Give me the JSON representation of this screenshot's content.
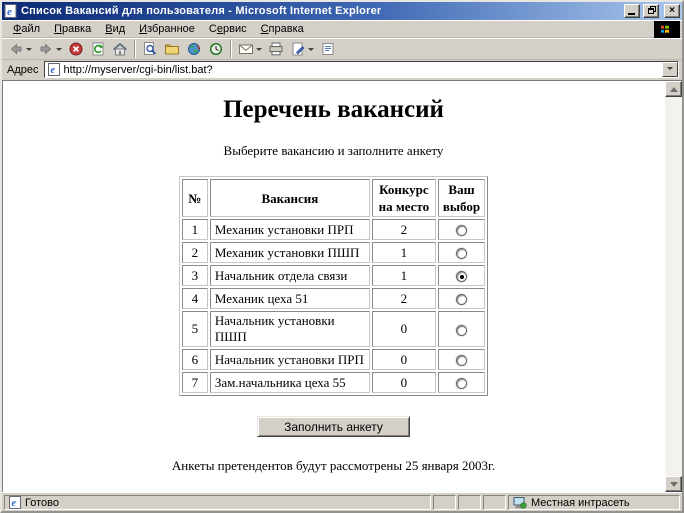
{
  "window": {
    "title": "Список Вакансий для пользователя - Microsoft Internet Explorer"
  },
  "menu": {
    "items": [
      {
        "id": "file",
        "label": "Файл",
        "underline": 0
      },
      {
        "id": "edit",
        "label": "Правка",
        "underline": 0
      },
      {
        "id": "view",
        "label": "Вид",
        "underline": 0
      },
      {
        "id": "favorites",
        "label": "Избранное",
        "underline": 0
      },
      {
        "id": "tools",
        "label": "Сервис",
        "underline": 1
      },
      {
        "id": "help",
        "label": "Справка",
        "underline": 0
      }
    ]
  },
  "toolbar": {
    "icons": [
      "back-icon",
      "forward-icon",
      "stop-icon",
      "refresh-icon",
      "home-icon",
      "search-icon",
      "favorites-icon",
      "media-icon",
      "history-icon",
      "mail-icon",
      "print-icon",
      "edit-icon",
      "discuss-icon"
    ]
  },
  "address_bar": {
    "label": "Адрес",
    "value": "http://myserver/cgi-bin/list.bat?"
  },
  "page": {
    "title": "Перечень вакансий",
    "subtitle": "Выберите вакансию и заполните анкету",
    "table": {
      "headers": [
        "№",
        "Вакансия",
        "Конкурс на место",
        "Ваш выбор"
      ],
      "rows": [
        {
          "num": "1",
          "vacancy": "Механик установки ПРП",
          "competition": "2",
          "selected": false
        },
        {
          "num": "2",
          "vacancy": "Механик установки ПШП",
          "competition": "1",
          "selected": false
        },
        {
          "num": "3",
          "vacancy": "Начальник отдела связи",
          "competition": "1",
          "selected": true
        },
        {
          "num": "4",
          "vacancy": "Механик цеха 51",
          "competition": "2",
          "selected": false
        },
        {
          "num": "5",
          "vacancy": "Начальник установки ПШП",
          "competition": "0",
          "selected": false
        },
        {
          "num": "6",
          "vacancy": "Начальник установки ПРП",
          "competition": "0",
          "selected": false
        },
        {
          "num": "7",
          "vacancy": "Зам.начальника цеха 55",
          "competition": "0",
          "selected": false
        }
      ]
    },
    "button_label": "Заполнить анкету",
    "footer": "Анкеты претендентов будут рассмотрены 25 января 2003г."
  },
  "status_bar": {
    "ready": "Готово",
    "zone": "Местная интрасеть"
  },
  "colors": {
    "titlebar_left": "#0b2a75",
    "titlebar_right": "#a9c6ec",
    "chrome": "#d4d0c8",
    "page_background": "#ffffff"
  }
}
